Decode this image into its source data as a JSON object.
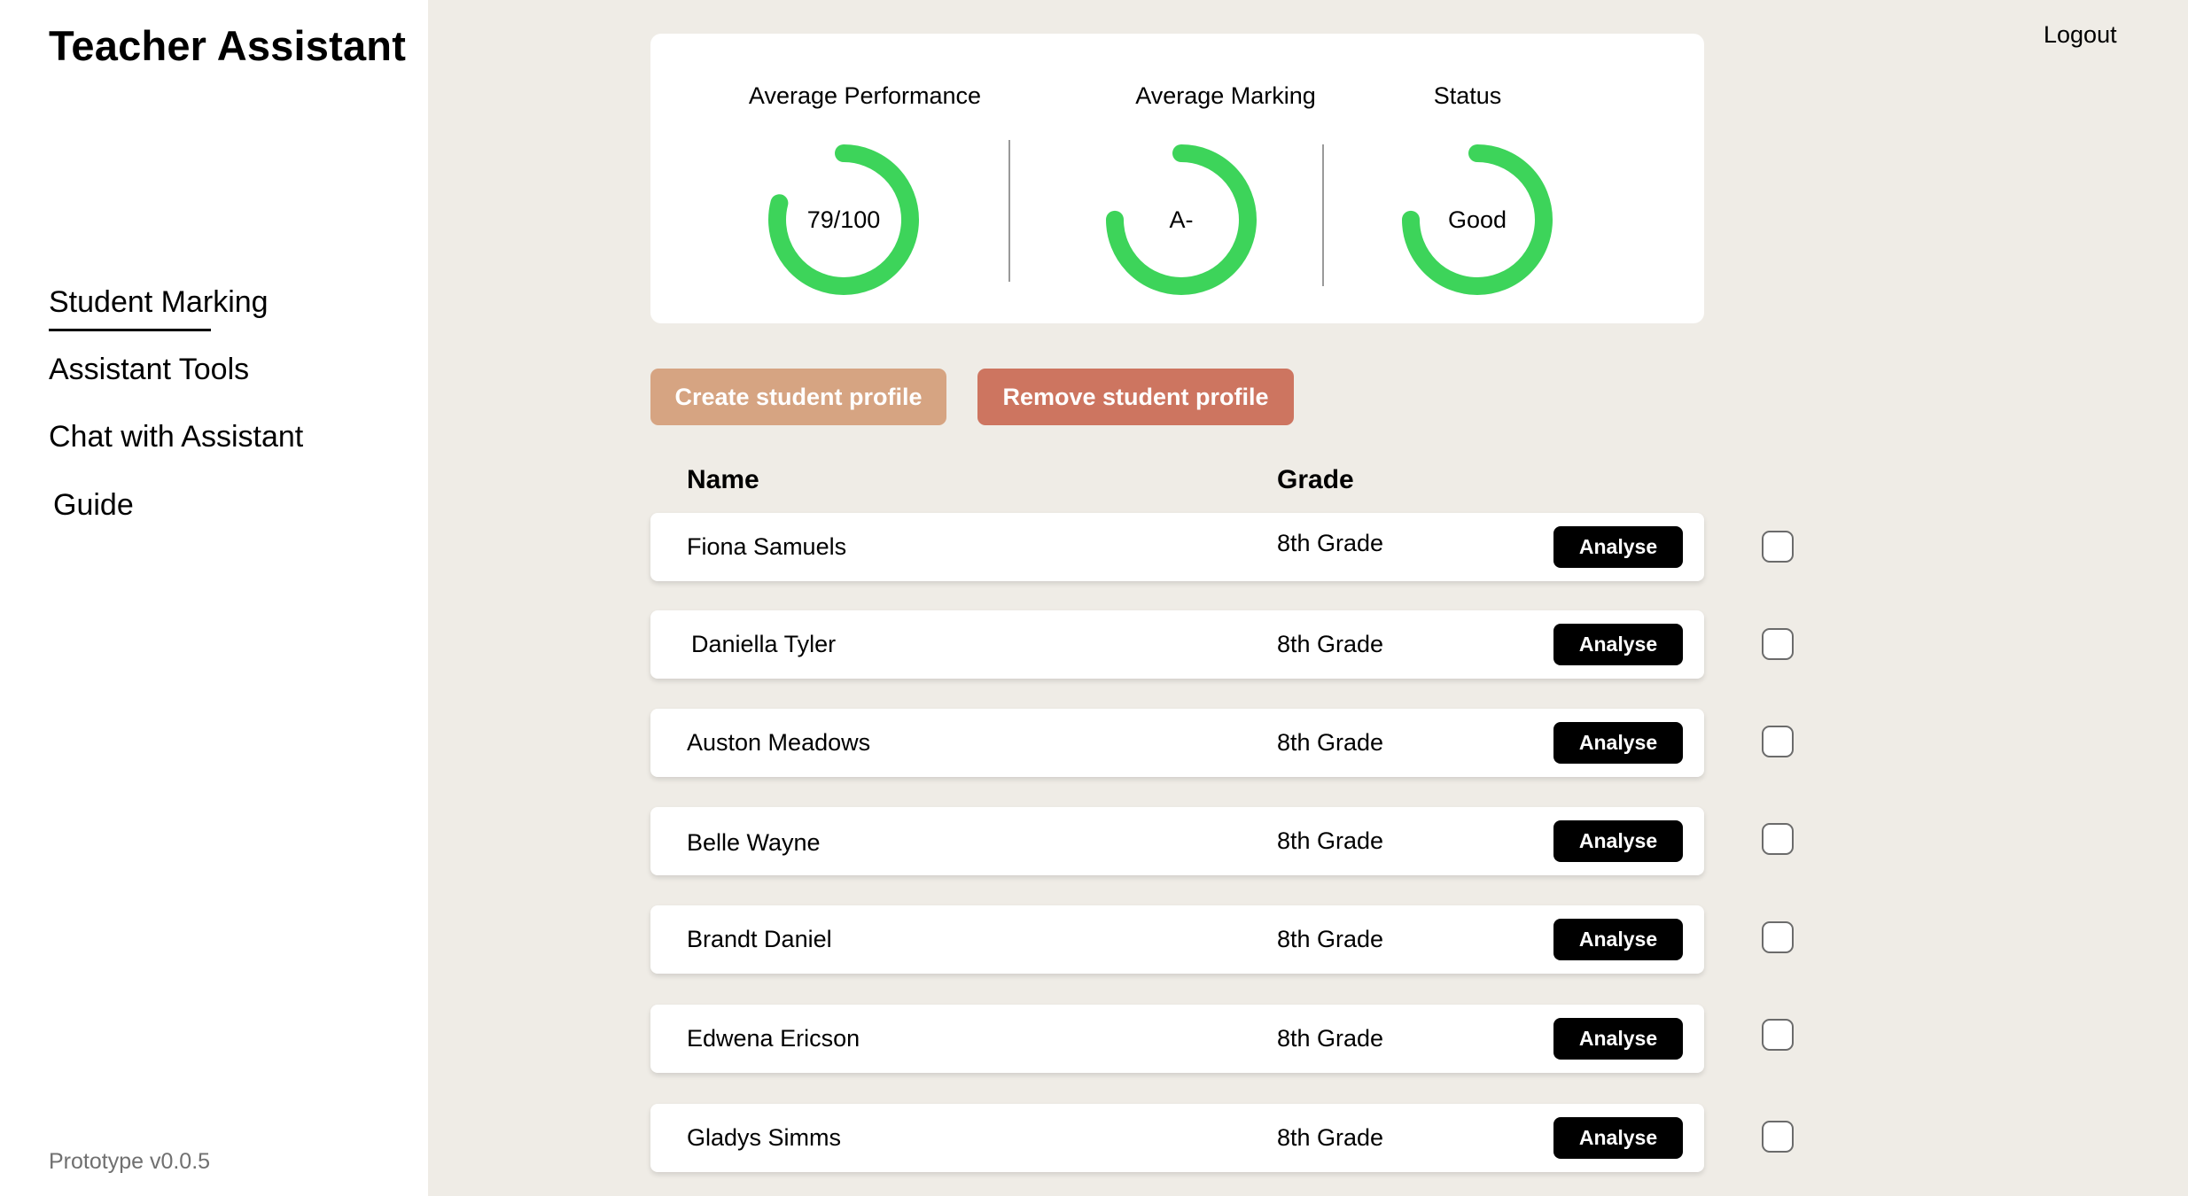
{
  "app": {
    "title": "Teacher Assistant",
    "version": "Prototype v0.0.5"
  },
  "nav": {
    "items": [
      {
        "label": "Student Marking",
        "active": true
      },
      {
        "label": "Assistant Tools"
      },
      {
        "label": "Chat with Assistant"
      },
      {
        "label": "Guide"
      }
    ]
  },
  "header": {
    "logout_label": "Logout"
  },
  "stats": [
    {
      "label": "Average Performance",
      "value": "79/100",
      "progress": 0.79,
      "color": "#3dd45a"
    },
    {
      "label": "Average Marking",
      "value": "A-",
      "progress": 0.75,
      "color": "#3dd45a"
    },
    {
      "label": "Status",
      "value": "Good",
      "progress": 0.75,
      "color": "#3dd45a"
    }
  ],
  "actions": {
    "create_label": "Create student profile",
    "remove_label": "Remove student profile"
  },
  "table": {
    "headers": {
      "name": "Name",
      "grade": "Grade"
    },
    "analyse_label": "Analyse",
    "rows": [
      {
        "name": "Fiona Samuels",
        "grade": "8th Grade"
      },
      {
        "name": "Daniella Tyler",
        "grade": "8th Grade"
      },
      {
        "name": "Auston Meadows",
        "grade": "8th Grade"
      },
      {
        "name": "Belle Wayne",
        "grade": "8th Grade"
      },
      {
        "name": "Brandt Daniel",
        "grade": "8th Grade"
      },
      {
        "name": "Edwena Ericson",
        "grade": "8th Grade"
      },
      {
        "name": "Gladys Simms",
        "grade": "8th Grade"
      }
    ]
  }
}
